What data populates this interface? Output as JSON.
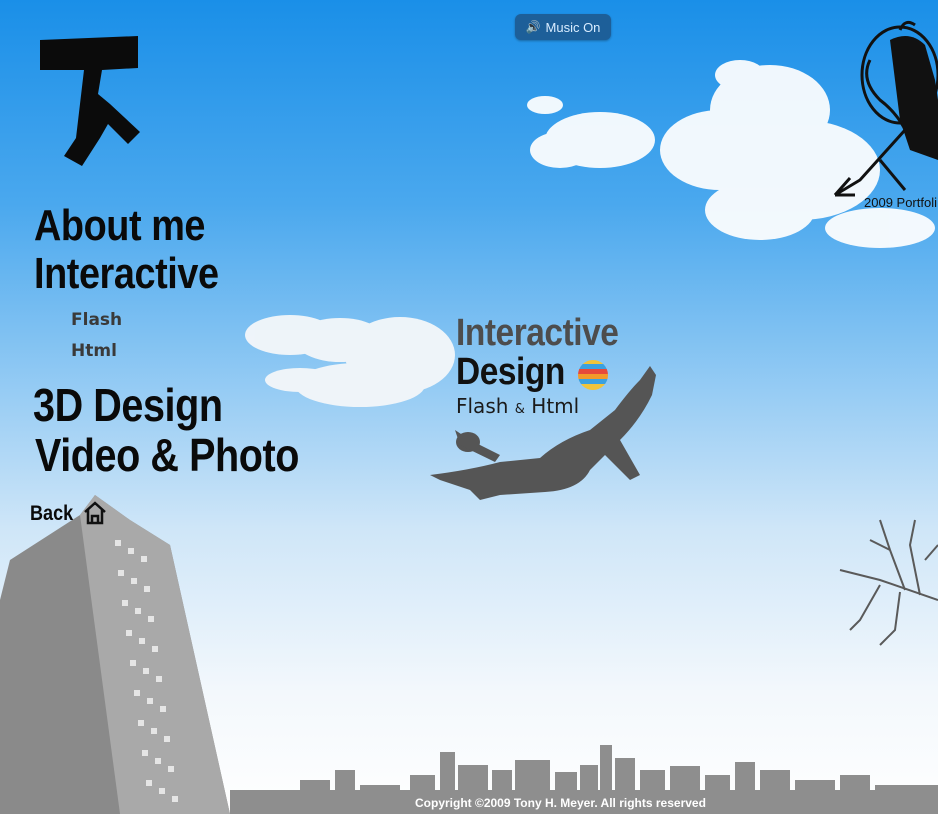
{
  "music": {
    "label": "Music On",
    "icon": "speaker-icon"
  },
  "nav": {
    "about": "About me",
    "interactive": "Interactive",
    "flash": "Flash",
    "html": "Html",
    "design3d": "3D Design",
    "video": "Video & Photo",
    "back": "Back"
  },
  "hero": {
    "line1": "Interactive",
    "line2": "Design",
    "sub_a": "Flash",
    "sub_amp": "&",
    "sub_b": "Html"
  },
  "portfolio": {
    "label": "2009 Portfoli"
  },
  "footer": {
    "copyright": "Copyright ©2009 Tony H. Meyer. All rights reserved"
  },
  "colors": {
    "sky_top": "#1a8fe8",
    "button": "#1d5f99",
    "silhouette": "#555555"
  }
}
